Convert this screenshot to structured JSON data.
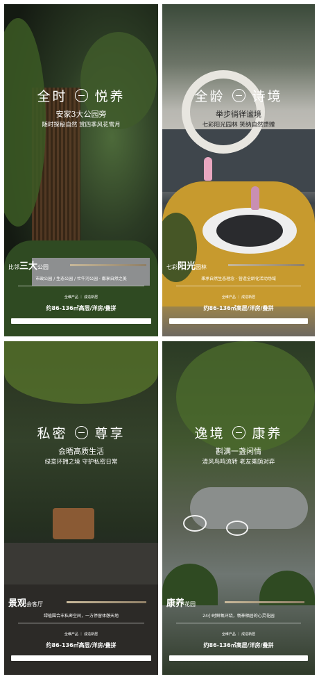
{
  "posters": [
    {
      "heading_left": "全时",
      "heading_right": "悦养",
      "subtitle": "安家3大公园旁",
      "tagline": "随时探秘自然 赏四季风花雪月",
      "venue_prefix": "比邻",
      "venue_bold": "三大",
      "venue_suffix": "公园",
      "description": "市政公园 / 生态公园 / 忙牛河公园 · 都享自然之美",
      "meta": "全维产品 ｜ 成造新居",
      "area": "约86-136㎡高层/洋房/叠拼"
    },
    {
      "heading_left": "全龄",
      "heading_right": "诗境",
      "subtitle": "举步徜徉谧境",
      "tagline": "七彩阳光园林 笑纳自然馈赠",
      "venue_prefix": "七彩",
      "venue_bold": "阳光",
      "venue_suffix": "园林",
      "description": "秉承自然生态理念 · 营造全龄化活动场域",
      "meta": "全维产品 ｜ 成造新居",
      "area": "约86-136㎡高层/洋房/叠拼"
    },
    {
      "heading_left": "私密",
      "heading_right": "尊享",
      "subtitle": "会晤高质生活",
      "tagline": "绿意环拥之境 守护私密日常",
      "venue_prefix": "",
      "venue_bold": "景观",
      "venue_suffix": "会客厅",
      "description": "绿植围合丰私密空间，一方停留体憩天地",
      "meta": "全维产品 ｜ 成造新居",
      "area": "约86-136㎡高层/洋房/叠拼"
    },
    {
      "heading_left": "逸境",
      "heading_right": "康养",
      "subtitle": "斟满一盏闲情",
      "tagline": "清风鸟鸣流转 老友乘荫对弈",
      "venue_prefix": "",
      "venue_bold": "康养",
      "venue_suffix": "花园",
      "description": "24小时鲜氧环绕，畅神栖居的心灵花园",
      "meta": "全维产品 ｜ 成造新居",
      "area": "约86-136㎡高层/洋房/叠拼"
    }
  ],
  "colors": {
    "accent_bar": "#c7b89a",
    "yellow_floor": "#c79a2e"
  }
}
